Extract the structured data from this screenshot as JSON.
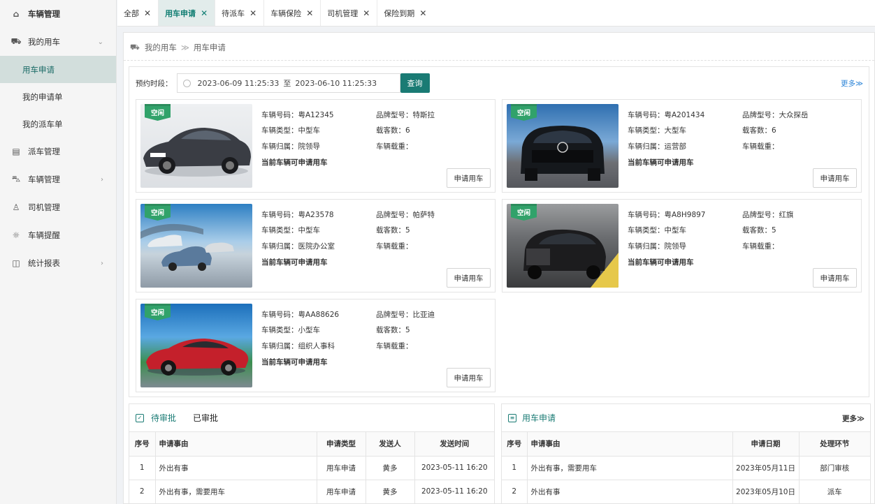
{
  "sidebar": {
    "title": "车辆管理",
    "my_car": "我的用车",
    "subs": [
      "用车申请",
      "我的申请单",
      "我的派车单"
    ],
    "items": [
      "派车管理",
      "车辆管理",
      "司机管理",
      "车辆提醒",
      "统计报表"
    ]
  },
  "tabs": [
    "全部",
    "用车申请",
    "待派车",
    "车辆保险",
    "司机管理",
    "保险到期"
  ],
  "breadcrumb": {
    "root": "我的用车",
    "sep": "≫",
    "current": "用车申请"
  },
  "filter": {
    "label": "预约时段：",
    "start": "2023-06-09 11:25:33",
    "to": "至",
    "end": "2023-06-10 11:25:33",
    "query_label": "查询",
    "more": "更多≫"
  },
  "card_labels": {
    "plate": "车辆号码：",
    "brand": "品牌型号：",
    "type": "车辆类型：",
    "seats": "载客数：",
    "owner": "车辆归属：",
    "load": "车辆载重：",
    "note": "当前车辆可申请用车",
    "apply": "申请用车",
    "tag": "空闲"
  },
  "cars": [
    {
      "plate": "粤A12345",
      "brand": "特斯拉",
      "type": "中型车",
      "seats": "6",
      "owner": "院领导",
      "load": "",
      "color": "#3a3d44"
    },
    {
      "plate": "粤A201434",
      "brand": "大众探岳",
      "type": "大型车",
      "seats": "6",
      "owner": "运营部",
      "load": "",
      "color": "#15181c"
    },
    {
      "plate": "粤A23578",
      "brand": "帕萨特",
      "type": "中型车",
      "seats": "5",
      "owner": "医院办公室",
      "load": "",
      "color": "#cfd6de"
    },
    {
      "plate": "粤A8H9897",
      "brand": "红旗",
      "type": "中型车",
      "seats": "5",
      "owner": "院领导",
      "load": "",
      "color": "#1c1c1e"
    },
    {
      "plate": "粤AA88626",
      "brand": "比亚迪",
      "type": "小型车",
      "seats": "5",
      "owner": "组织人事科",
      "load": "",
      "color": "#c4202b"
    }
  ],
  "approval": {
    "tab_pending": "待审批",
    "tab_done": "已审批",
    "headers": [
      "序号",
      "申请事由",
      "申请类型",
      "发送人",
      "发送时间"
    ],
    "rows": [
      [
        "1",
        "外出有事",
        "用车申请",
        "黄多",
        "2023-05-11 16:20"
      ],
      [
        "2",
        "外出有事，需要用车",
        "用车申请",
        "黄多",
        "2023-05-11 16:20"
      ]
    ]
  },
  "apply_list": {
    "title": "用车申请",
    "more": "更多≫",
    "headers": [
      "序号",
      "申请事由",
      "申请日期",
      "处理环节"
    ],
    "rows": [
      [
        "1",
        "外出有事，需要用车",
        "2023年05月11日",
        "部门审核"
      ],
      [
        "2",
        "外出有事",
        "2023年05月10日",
        "派车"
      ]
    ]
  }
}
